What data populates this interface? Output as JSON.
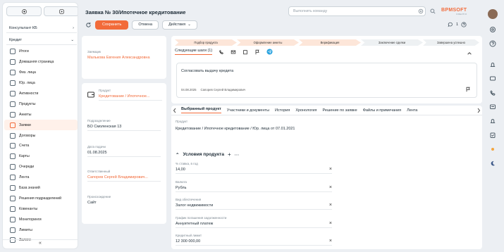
{
  "sidebar": {
    "workspace": "Консультант КБ",
    "section": "Кредит",
    "items": [
      {
        "label": "Итоги"
      },
      {
        "label": "Домашняя страница"
      },
      {
        "label": "Физ. лица"
      },
      {
        "label": "Юр. лица"
      },
      {
        "label": "Активности"
      },
      {
        "label": "Продукты"
      },
      {
        "label": "Анкеты"
      },
      {
        "label": "Заявки",
        "active": true
      },
      {
        "label": "Договоры"
      },
      {
        "label": "Счета"
      },
      {
        "label": "Карты"
      },
      {
        "label": "Очереди"
      },
      {
        "label": "Лента"
      },
      {
        "label": "База знаний"
      },
      {
        "label": "Решения подразделений"
      },
      {
        "label": "Ковенанты"
      },
      {
        "label": "Мониторинги"
      },
      {
        "label": "Лимиты"
      },
      {
        "label": "Залоги"
      }
    ],
    "collapse_glyph": "«"
  },
  "header": {
    "title": "Заявка № 30/Ипотечное кредитование"
  },
  "command": {
    "placeholder": "Выполнить команду"
  },
  "logo": {
    "name": "BPMSOFT",
    "sub": "CREATIO"
  },
  "toolbar": {
    "save": "Сохранить",
    "cancel": "Отмена",
    "actions": "Действия",
    "counter": "1"
  },
  "left": {
    "applicant_label": "Заемщик",
    "applicant_value": "Малькова Евгения Александровна",
    "product_label": "Продукт",
    "product_value": "Кредитование / Ипотечное...",
    "division_label": "Подразделение",
    "division_value": "БО Смоленская 13",
    "date_label": "Дата подачи",
    "date_value": "01.08.2025",
    "owner_label": "Ответственный",
    "owner_value": "Сапорев Сергей Владимирович...",
    "source_label": "Происхождение",
    "source_value": "Сайт"
  },
  "stages": [
    "Подбор продукта",
    "Оформление анкеты",
    "Верификация",
    "Заключение сделки",
    "Завершена успешно"
  ],
  "next_steps": {
    "title": "Следующие шаги (1)",
    "task": "Согласовать выдачу кредита",
    "task_date": "04.08.2025",
    "task_owner": "Сапорев Сергей Владимирович"
  },
  "tabs": [
    "Выбранный продукт",
    "Участники и документы",
    "История",
    "Хронология",
    "Решение по заявке",
    "Файлы и примечания",
    "Лента"
  ],
  "product": {
    "label": "Продукт",
    "value": "Кредитование / Ипотечное кредитование / Юр. лица от 07.01.2021"
  },
  "conditions": {
    "title": "Условия продукта",
    "fields": [
      {
        "label": "% ставка, в год",
        "value": "14,00"
      },
      {
        "label": "Валюта",
        "value": "Рубль"
      },
      {
        "label": "Вид обеспечения",
        "value": "Залог недвижимости"
      },
      {
        "label": "График погашения задолженности",
        "value": "Аннуитетный платеж"
      },
      {
        "label": "Кредитный лимит",
        "value": "12 300 000,00"
      }
    ]
  },
  "colors": {
    "accent": "#f26b3a"
  }
}
